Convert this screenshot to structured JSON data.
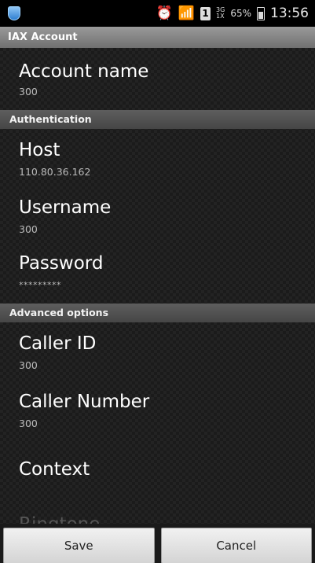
{
  "status_bar": {
    "alarm_icon": "alarm-clock-icon",
    "wifi_icon": "wifi-icon",
    "sim": "1",
    "network_top": "3G",
    "network_bottom": "1X",
    "battery_percent": "65%",
    "time": "13:56"
  },
  "title": "IAX Account",
  "sections": {
    "account": {
      "items": [
        {
          "title": "Account name",
          "summary": "300"
        }
      ]
    },
    "authentication": {
      "header": "Authentication",
      "items": [
        {
          "title": "Host",
          "summary": "110.80.36.162"
        },
        {
          "title": "Username",
          "summary": "300"
        },
        {
          "title": "Password",
          "summary": "*********"
        }
      ]
    },
    "advanced": {
      "header": "Advanced options",
      "items": [
        {
          "title": "Caller ID",
          "summary": "300"
        },
        {
          "title": "Caller Number",
          "summary": "300"
        },
        {
          "title": "Context",
          "summary": ""
        },
        {
          "title": "Ringtone",
          "summary": ""
        }
      ]
    }
  },
  "buttons": {
    "save": "Save",
    "cancel": "Cancel"
  }
}
